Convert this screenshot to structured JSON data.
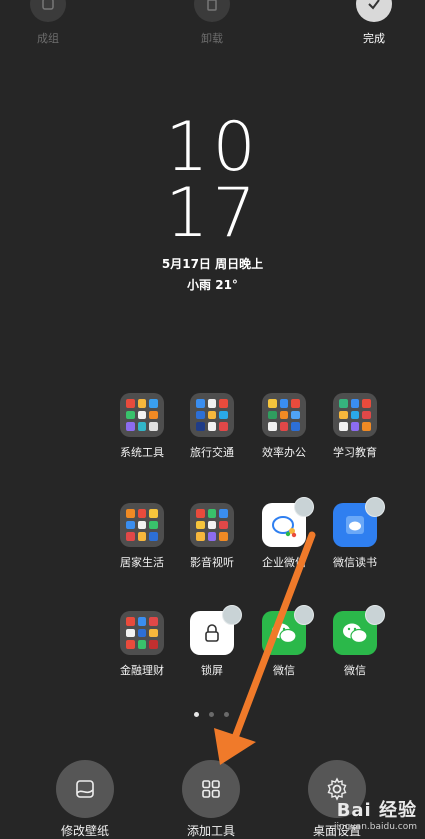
{
  "top_bar": {
    "group_label": "成组",
    "uninstall_label": "卸载",
    "done_label": "完成"
  },
  "widget": {
    "hour": "10",
    "minute": "17",
    "date": "5月17日 周日晚上",
    "weather": "小雨 21°"
  },
  "grid": {
    "row1": [
      "系统工具",
      "旅行交通",
      "效率办公",
      "学习教育"
    ],
    "row2": [
      "居家生活",
      "影音视听",
      "企业微信",
      "微信读书"
    ],
    "row3": [
      "金融理财",
      "锁屏",
      "微信",
      "微信"
    ]
  },
  "dock": {
    "wallpaper_label": "修改壁纸",
    "widgets_label": "添加工具",
    "settings_label": "桌面设置"
  },
  "pager": {
    "pages": 3,
    "active_index": 0
  },
  "colors": {
    "background": "#262626",
    "arrow": "#f07a2a",
    "wechat_green": "#2bb84a",
    "read_blue": "#2f7ff0"
  },
  "watermark": {
    "brand": "Bai 经验",
    "url": "jingyan.baidu.com"
  }
}
